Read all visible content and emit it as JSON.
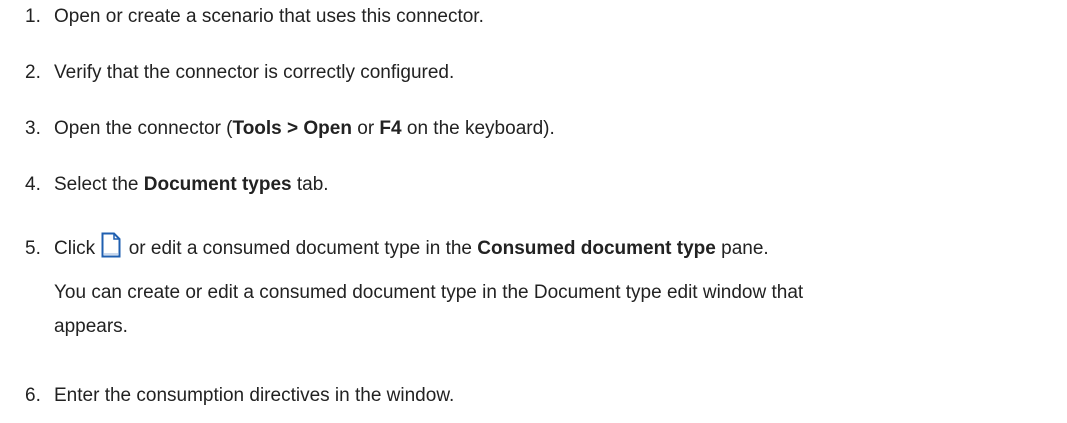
{
  "steps": [
    {
      "num": "1.",
      "text": "Open or create a scenario that uses this connector."
    },
    {
      "num": "2.",
      "text": "Verify that the connector is correctly configured."
    },
    {
      "num": "3.",
      "pre": "Open the connector (",
      "b1": "Tools > Open",
      "mid": " or ",
      "b2": "F4",
      "post": " on the keyboard)."
    },
    {
      "num": "4.",
      "pre": "Select the ",
      "b1": "Document types",
      "post": " tab."
    },
    {
      "num": "5.",
      "pre": "Click ",
      "mid": " or edit a consumed document type in the ",
      "b1": "Consumed document type",
      "post": " pane.",
      "sub1": "You can create or edit a consumed document type in the Document type edit window that",
      "sub2": "appears."
    },
    {
      "num": "6.",
      "text": "Enter the consumption directives in the window."
    }
  ],
  "icons": {
    "new_document": "new-document-icon"
  },
  "colors": {
    "text": "#222222",
    "icon_border": "#1f5fb0",
    "icon_fill": "#ffffff"
  }
}
